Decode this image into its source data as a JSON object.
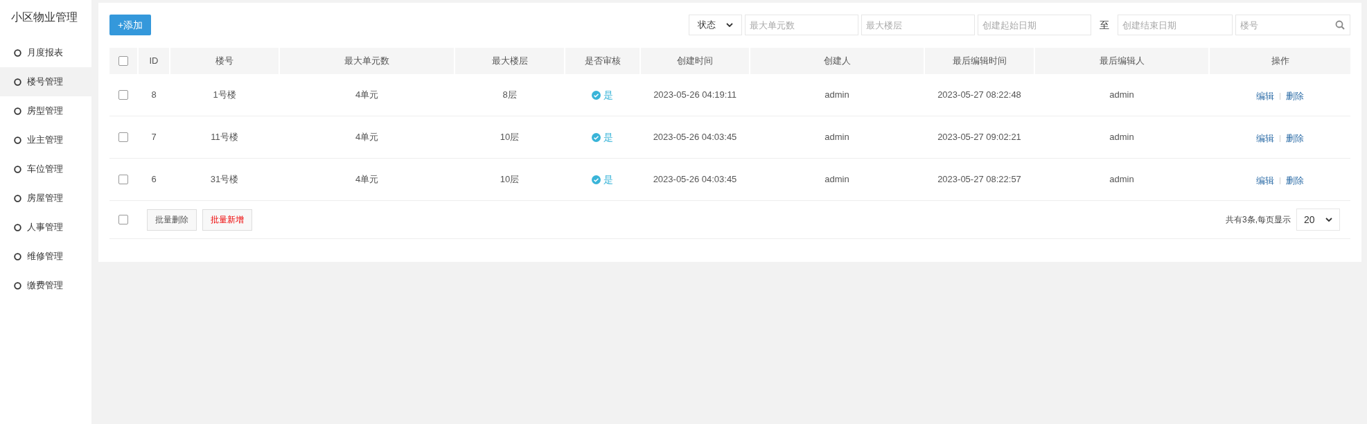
{
  "sidebar": {
    "title": "小区物业管理",
    "items": [
      {
        "label": "月度报表",
        "selected": false
      },
      {
        "label": "楼号管理",
        "selected": true
      },
      {
        "label": "房型管理",
        "selected": false
      },
      {
        "label": "业主管理",
        "selected": false
      },
      {
        "label": "车位管理",
        "selected": false
      },
      {
        "label": "房屋管理",
        "selected": false
      },
      {
        "label": "人事管理",
        "selected": false
      },
      {
        "label": "维修管理",
        "selected": false
      },
      {
        "label": "缴费管理",
        "selected": false
      }
    ]
  },
  "toolbar": {
    "add_button": "+添加",
    "status_select": "状态",
    "filters": [
      {
        "placeholder": "最大单元数"
      },
      {
        "placeholder": "最大楼层"
      },
      {
        "placeholder": "创建起始日期"
      }
    ],
    "range_separator": "至",
    "end_filter": {
      "placeholder": "创建结束日期"
    },
    "search": {
      "placeholder": "楼号"
    }
  },
  "table": {
    "all_checked": false,
    "columns": [
      "ID",
      "楼号",
      "最大单元数",
      "最大楼层",
      "是否审核",
      "创建时间",
      "创建人",
      "最后编辑时间",
      "最后编辑人",
      "操作"
    ],
    "rows": [
      {
        "checked": false,
        "id": "8",
        "building": "1号楼",
        "units": "4单元",
        "floors": "8层",
        "approved": true,
        "audit": "是",
        "created": "2023-05-26 04:19:11",
        "creator": "admin",
        "edited": "2023-05-27 08:22:48",
        "editor": "admin",
        "actions": [
          "编辑",
          "删除"
        ]
      },
      {
        "checked": false,
        "id": "7",
        "building": "11号楼",
        "units": "4单元",
        "floors": "10层",
        "approved": true,
        "audit": "是",
        "created": "2023-05-26 04:03:45",
        "creator": "admin",
        "edited": "2023-05-27 09:02:21",
        "editor": "admin",
        "actions": [
          "编辑",
          "删除"
        ]
      },
      {
        "checked": false,
        "id": "6",
        "building": "31号楼",
        "units": "4单元",
        "floors": "10层",
        "approved": true,
        "audit": "是",
        "created": "2023-05-26 04:03:45",
        "creator": "admin",
        "edited": "2023-05-27 08:22:57",
        "editor": "admin",
        "actions": [
          "编辑",
          "删除"
        ]
      }
    ],
    "footer": {
      "checked": false,
      "batch_delete": "批量删除",
      "batch_add": "批量新增",
      "total": "共有3条,每页显示",
      "page_size": "20"
    }
  }
}
